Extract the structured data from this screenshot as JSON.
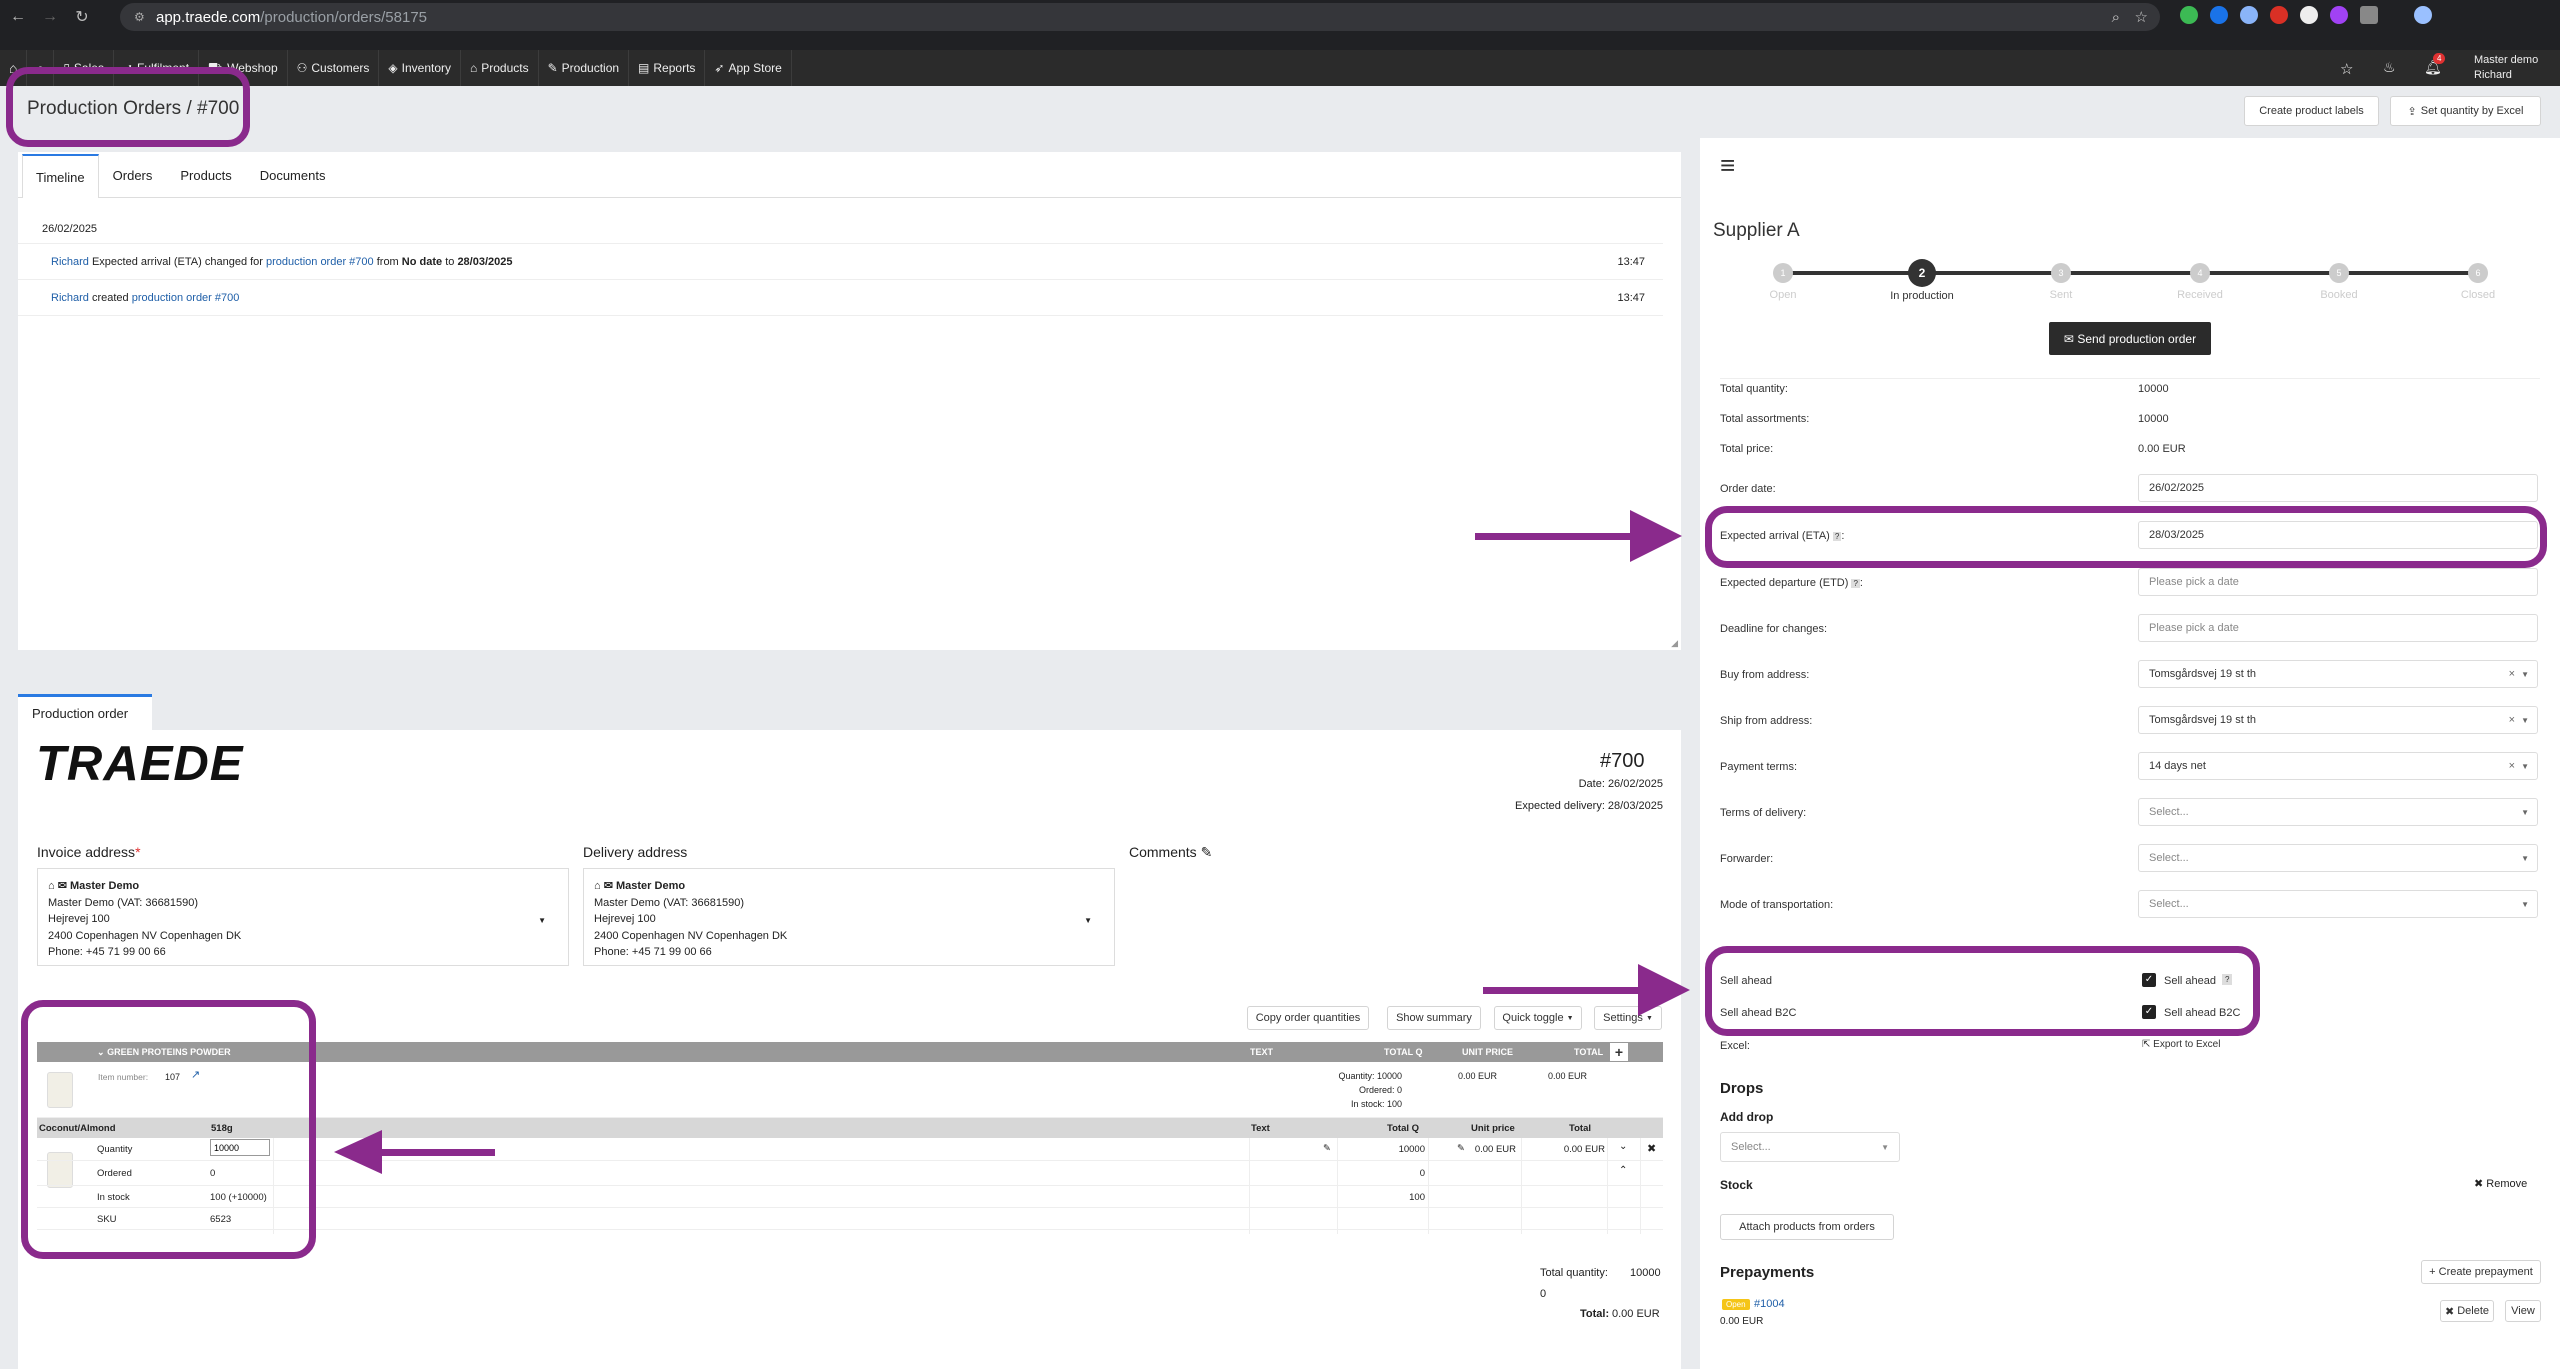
{
  "browser": {
    "url_host": "app.traede.com",
    "url_path": "/production/orders/58175"
  },
  "nav": {
    "items": [
      "Sales",
      "Fulfilment",
      "Webshop",
      "Customers",
      "Inventory",
      "Products",
      "Production",
      "Reports",
      "App Store"
    ],
    "user_line1": "Master demo",
    "user_line2": "Richard",
    "notif_count": "4"
  },
  "page": {
    "title": "Production Orders / #700",
    "create_labels": "Create product labels",
    "set_qty_excel": "Set quantity by Excel"
  },
  "tabs": [
    "Timeline",
    "Orders",
    "Products",
    "Documents"
  ],
  "timeline": {
    "date": "26/02/2025",
    "e1": {
      "user": "Richard",
      "text1": "Expected arrival (ETA) changed for",
      "link": "production order #700",
      "text2": "from",
      "from": "No date",
      "text3": "to",
      "to": "28/03/2025",
      "time": "13:47"
    },
    "e2": {
      "user": "Richard",
      "text1": "created",
      "link": "production order #700",
      "time": "13:47"
    }
  },
  "po": {
    "tab": "Production order",
    "logo": "TRAEDE",
    "number": "#700",
    "date": "Date: 26/02/2025",
    "exp_delivery": "Expected delivery: 28/03/2025",
    "invoice_label": "Invoice address",
    "required_mark": "*",
    "delivery_label": "Delivery address",
    "comments_label": "Comments",
    "invoice": {
      "name": "Master Demo",
      "l1": "Master Demo (VAT: 36681590)",
      "l2": "Hejrevej 100",
      "l3": "2400 Copenhagen NV Copenhagen DK",
      "l4": "Phone: +45 71 99 00 66"
    },
    "delivery": {
      "name": "Master Demo",
      "l1": "Master Demo (VAT: 36681590)",
      "l2": "Hejrevej 100",
      "l3": "2400 Copenhagen NV Copenhagen DK",
      "l4": "Phone: +45 71 99 00 66"
    },
    "btn_copy": "Copy order quantities",
    "btn_summary": "Show summary",
    "btn_quick": "Quick toggle",
    "btn_settings": "Settings",
    "grid": {
      "product": "GREEN PROTEINS POWDER",
      "h_text": "TEXT",
      "h_totalq": "TOTAL Q",
      "h_unit": "UNIT PRICE",
      "h_total": "TOTAL",
      "item_label": "Item number:",
      "item_no": "107",
      "sum_q": "Quantity: 10000",
      "sum_ord": "Ordered: 0",
      "sum_stock": "In stock: 100",
      "sum_unit": "0.00 EUR",
      "sum_total": "0.00 EUR",
      "variant": "Coconut/Almond",
      "size": "518g",
      "v_text": "Text",
      "v_totalq": "Total Q",
      "v_unit": "Unit price",
      "v_total": "Total",
      "r_qty": "Quantity",
      "qty_val": "10000",
      "r_qty_tq": "10000",
      "r_qty_unit": "0.00 EUR",
      "r_qty_total": "0.00 EUR",
      "r_ord": "Ordered",
      "ord_val": "0",
      "ord_tq": "0",
      "r_stock": "In stock",
      "stock_val": "100 (+10000)",
      "stock_tq": "100",
      "r_sku": "SKU",
      "sku_val": "6523"
    },
    "totals": {
      "tq_label": "Total quantity:",
      "tq_val": "10000",
      "zero": "0",
      "total_label": "Total:",
      "total_val": "0.00 EUR"
    }
  },
  "supplier": {
    "name": "Supplier A",
    "steps": [
      {
        "n": "1",
        "l": "Open"
      },
      {
        "n": "2",
        "l": "In production"
      },
      {
        "n": "3",
        "l": "Sent"
      },
      {
        "n": "4",
        "l": "Received"
      },
      {
        "n": "5",
        "l": "Booked"
      },
      {
        "n": "6",
        "l": "Closed"
      }
    ],
    "send_btn": "Send production order",
    "tq_l": "Total quantity:",
    "tq_v": "10000",
    "ta_l": "Total assortments:",
    "ta_v": "10000",
    "tp_l": "Total price:",
    "tp_v": "0.00 EUR",
    "od_l": "Order date:",
    "od_v": "26/02/2025",
    "eta_l": "Expected arrival (ETA)",
    "eta_v": "28/03/2025",
    "etd_l": "Expected departure (ETD)",
    "etd_ph": "Please pick a date",
    "dl_l": "Deadline for changes:",
    "dl_ph": "Please pick a date",
    "buy_l": "Buy from address:",
    "buy_v": "Tomsgårdsvej 19 st th",
    "ship_l": "Ship from address:",
    "ship_v": "Tomsgårdsvej 19 st th",
    "pay_l": "Payment terms:",
    "pay_v": "14 days net",
    "tod_l": "Terms of delivery:",
    "fwd_l": "Forwarder:",
    "mot_l": "Mode of transportation:",
    "select_ph": "Select...",
    "sa_l": "Sell ahead",
    "sa_c": "Sell ahead",
    "sab_l": "Sell ahead B2C",
    "sab_c": "Sell ahead B2C",
    "excel_l": "Excel:",
    "excel_btn": "Export to Excel",
    "drops": "Drops",
    "add_drop": "Add drop",
    "stock": "Stock",
    "remove": "Remove",
    "attach": "Attach products from orders",
    "prepay": "Prepayments",
    "create_prepay": "Create prepayment",
    "badge": "Open",
    "pp_no": "#1004",
    "pp_amt": "0.00 EUR",
    "delete": "Delete",
    "view": "View"
  }
}
